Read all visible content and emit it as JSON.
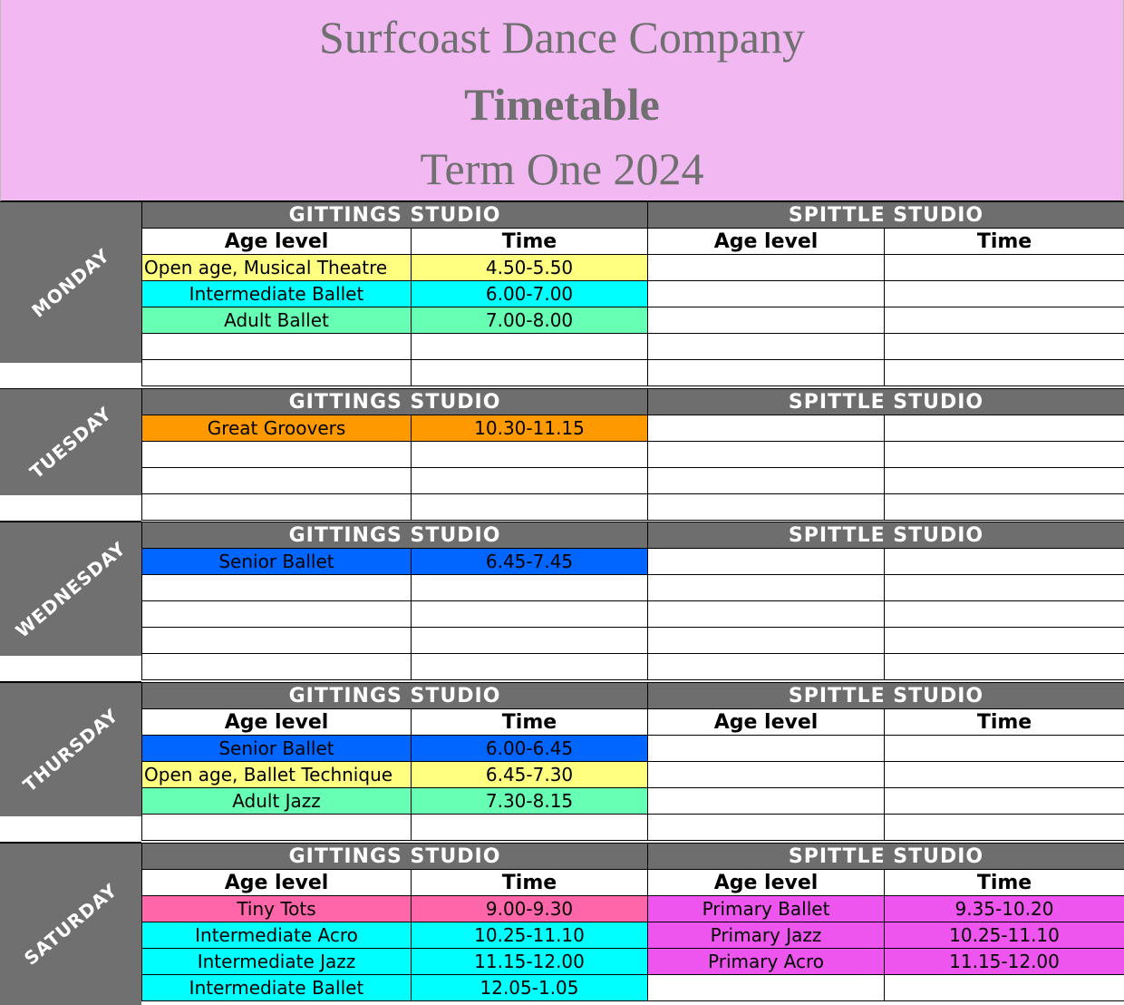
{
  "header": {
    "line1": "Surfcoast Dance Company",
    "line2": "Timetable",
    "line3": "Term One 2024"
  },
  "labels": {
    "gittings": "GITTINGS STUDIO",
    "spittle": "SPITTLE STUDIO",
    "age_level": "Age level",
    "time": "Time"
  },
  "colors": {
    "header_bg": "#f2b8f2",
    "day_bg": "#707070",
    "yellow": "#ffff80",
    "cyan": "#00ffff",
    "green": "#66ffb3",
    "orange": "#ff9900",
    "blue": "#0066ff",
    "pink": "#ff66aa",
    "magenta": "#ee55ee"
  },
  "days": {
    "monday": {
      "label": "MONDAY",
      "gittings": [
        {
          "class": "Open age, Musical Theatre",
          "time": "4.50-5.50"
        },
        {
          "class": "Intermediate Ballet",
          "time": "6.00-7.00"
        },
        {
          "class": "Adult Ballet",
          "time": "7.00-8.00"
        }
      ]
    },
    "tuesday": {
      "label": "TUESDAY",
      "gittings": [
        {
          "class": "Great Groovers",
          "time": "10.30-11.15"
        }
      ]
    },
    "wednesday": {
      "label": "WEDNESDAY",
      "gittings": [
        {
          "class": "Senior Ballet",
          "time": "6.45-7.45"
        }
      ]
    },
    "thursday": {
      "label": "THURSDAY",
      "gittings": [
        {
          "class": "Senior Ballet",
          "time": "6.00-6.45"
        },
        {
          "class": "Open age, Ballet Technique",
          "time": "6.45-7.30"
        },
        {
          "class": "Adult Jazz",
          "time": "7.30-8.15"
        }
      ]
    },
    "saturday": {
      "label": "SATURDAY",
      "gittings": [
        {
          "class": "Tiny Tots",
          "time": "9.00-9.30"
        },
        {
          "class": "Intermediate Acro",
          "time": "10.25-11.10"
        },
        {
          "class": "Intermediate Jazz",
          "time": "11.15-12.00"
        },
        {
          "class": "Intermediate Ballet",
          "time": "12.05-1.05"
        }
      ],
      "spittle": [
        {
          "class": "Primary Ballet",
          "time": "9.35-10.20"
        },
        {
          "class": "Primary Jazz",
          "time": "10.25-11.10"
        },
        {
          "class": "Primary Acro",
          "time": "11.15-12.00"
        }
      ]
    }
  }
}
